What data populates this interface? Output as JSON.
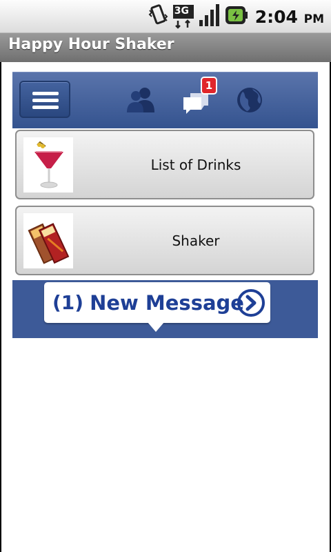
{
  "status_bar": {
    "network_label": "3G",
    "time": "2:04",
    "ampm": "PM",
    "icons": [
      "vibrate-icon",
      "3g-icon",
      "signal-icon",
      "battery-icon"
    ]
  },
  "app": {
    "title": "Happy Hour Shaker"
  },
  "top_nav": {
    "icons": [
      "menu-icon",
      "friends-icon",
      "messages-icon",
      "globe-icon"
    ],
    "messages_badge": "1"
  },
  "menu": {
    "items": [
      {
        "label": "List of Drinks",
        "icon": "cocktail-glass-icon"
      },
      {
        "label": "Shaker",
        "icon": "mixed-drink-glasses-icon"
      }
    ]
  },
  "banner": {
    "count": "(1)",
    "message": "New Message",
    "arrow_icon": "chevron-right-circle-icon"
  },
  "colors": {
    "nav_blue": "#3d5a98",
    "banner_text": "#1e3f96",
    "badge_red": "#e0262b",
    "title_bar": "#7f7f7f"
  }
}
